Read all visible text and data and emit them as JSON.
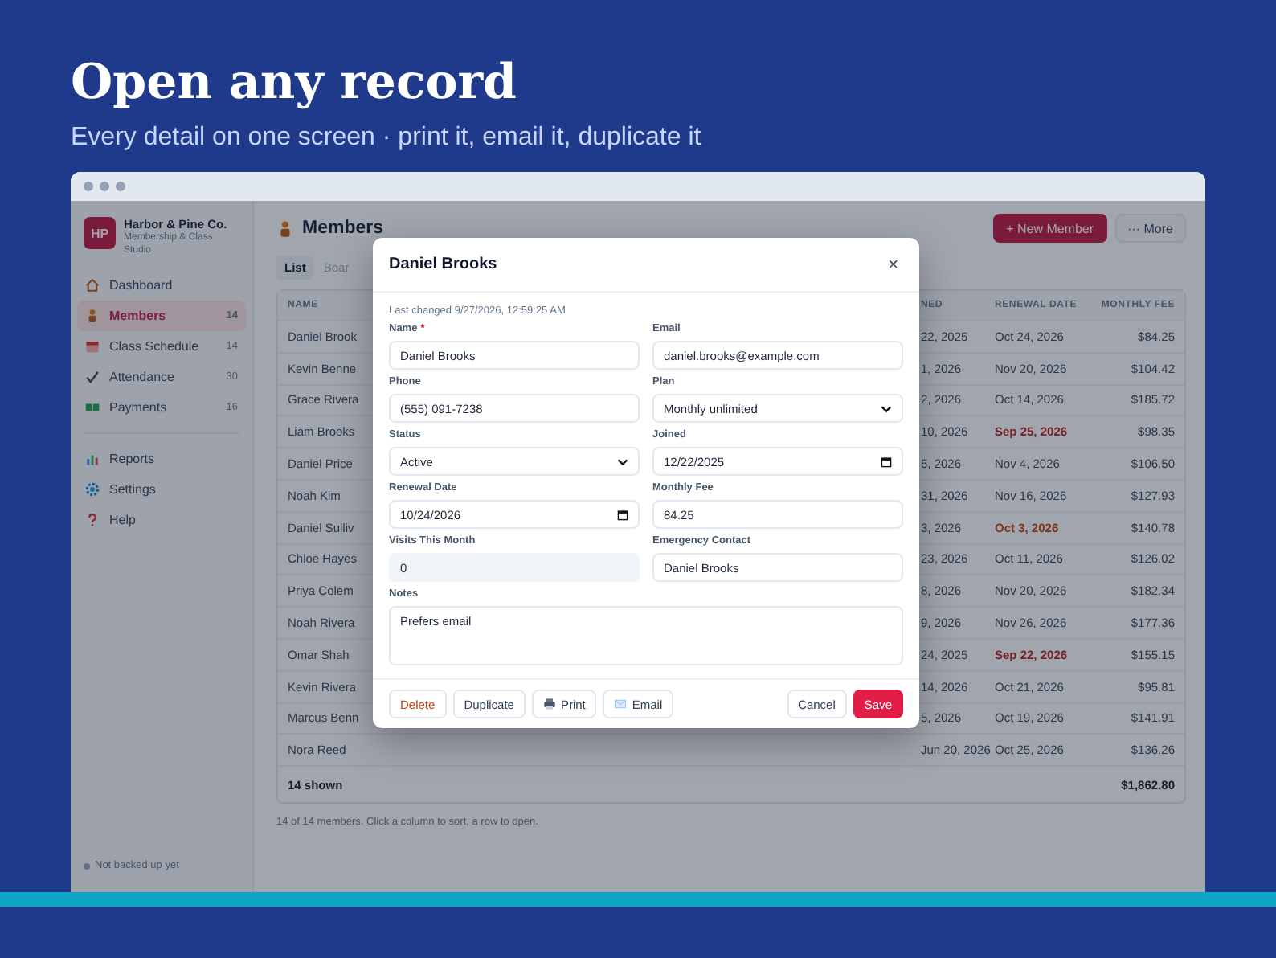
{
  "hero": {
    "title": "Open any record",
    "subtitle": "Every detail on one screen · print it, email it, duplicate it"
  },
  "app": {
    "brand": {
      "logo": "HP",
      "name": "Harbor & Pine Co.",
      "tagline": "Membership & Class Studio"
    },
    "nav_main": [
      {
        "label": "Dashboard",
        "selected": false
      },
      {
        "label": "Members",
        "count": "14",
        "selected": true
      },
      {
        "label": "Class Schedule",
        "count": "14",
        "selected": false
      },
      {
        "label": "Attendance",
        "count": "30",
        "selected": false
      },
      {
        "label": "Payments",
        "count": "16",
        "selected": false
      }
    ],
    "nav_secondary": [
      {
        "label": "Reports",
        "selected": false
      },
      {
        "label": "Settings",
        "selected": false
      },
      {
        "label": "Help",
        "selected": false
      }
    ],
    "backup_status": "Not backed up yet",
    "page_title": "Members",
    "actions": [
      {
        "kind": "primary",
        "label": "+ New Member"
      },
      {
        "kind": "plain",
        "label": "··· More"
      }
    ],
    "tabs": [
      {
        "label": "List",
        "selected": true
      },
      {
        "label": "Boar",
        "selected": false
      }
    ],
    "table": {
      "columns": [
        "NAME",
        "NED",
        "RENEWAL DATE",
        "MONTHLY FEE"
      ],
      "rows": [
        {
          "name": "Daniel Brook",
          "column_2": "22, 2025",
          "renewal": "Oct 24, 2026",
          "overdue": false,
          "due_soon": false,
          "fee": "$84.25"
        },
        {
          "name": "Kevin Benne",
          "column_2": "1, 2026",
          "renewal": "Nov 20, 2026",
          "overdue": false,
          "due_soon": false,
          "fee": "$104.42"
        },
        {
          "name": "Grace Rivera",
          "column_2": "2, 2026",
          "renewal": "Oct 14, 2026",
          "overdue": false,
          "due_soon": false,
          "fee": "$185.72"
        },
        {
          "name": "Liam Brooks",
          "column_2": "10, 2026",
          "renewal": "Sep 25, 2026",
          "overdue": true,
          "due_soon": false,
          "fee": "$98.35"
        },
        {
          "name": "Daniel Price",
          "column_2": "5, 2026",
          "renewal": "Nov 4, 2026",
          "overdue": false,
          "due_soon": false,
          "fee": "$106.50"
        },
        {
          "name": "Noah Kim",
          "column_2": "31, 2026",
          "renewal": "Nov 16, 2026",
          "overdue": false,
          "due_soon": false,
          "fee": "$127.93"
        },
        {
          "name": "Daniel Sulliv",
          "column_2": "3, 2026",
          "renewal": "Oct 3, 2026",
          "overdue": false,
          "due_soon": true,
          "fee": "$140.78"
        },
        {
          "name": "Chloe Hayes",
          "column_2": "23, 2026",
          "renewal": "Oct 11, 2026",
          "overdue": false,
          "due_soon": false,
          "fee": "$126.02"
        },
        {
          "name": "Priya Colem",
          "column_2": "8, 2026",
          "renewal": "Nov 20, 2026",
          "overdue": false,
          "due_soon": false,
          "fee": "$182.34"
        },
        {
          "name": "Noah Rivera",
          "column_2": "9, 2026",
          "renewal": "Nov 26, 2026",
          "overdue": false,
          "due_soon": false,
          "fee": "$177.36"
        },
        {
          "name": "Omar Shah",
          "column_2": "24, 2025",
          "renewal": "Sep 22, 2026",
          "overdue": true,
          "due_soon": false,
          "fee": "$155.15"
        },
        {
          "name": "Kevin Rivera",
          "column_2": "14, 2026",
          "renewal": "Oct 21, 2026",
          "overdue": false,
          "due_soon": false,
          "fee": "$95.81"
        },
        {
          "name": "Marcus Benn",
          "column_2": "5, 2026",
          "renewal": "Oct 19, 2026",
          "overdue": false,
          "due_soon": false,
          "fee": "$141.91"
        },
        {
          "name": "Nora Reed",
          "column_2": "Jun 20, 2026",
          "renewal": "Oct 25, 2026",
          "overdue": false,
          "due_soon": false,
          "fee": "$136.26"
        }
      ],
      "footer": {
        "count": "14 shown",
        "total": "$1,862.80"
      }
    },
    "caption": "14 of 14 members. Click a column to sort, a row to open."
  },
  "dialog": {
    "title": "Daniel Brooks",
    "close": "×",
    "last_changed": "Last changed 9/27/2026, 12:59:25 AM",
    "fields": [
      {
        "label": "Name",
        "required_mark": "*",
        "kind": "text",
        "value": "Daniel Brooks"
      },
      {
        "label": "Email",
        "kind": "text",
        "value": "daniel.brooks@example.com"
      },
      {
        "label": "Phone",
        "kind": "text",
        "value": "(555) 091-7238"
      },
      {
        "label": "Plan",
        "kind": "select",
        "value": "Monthly unlimited"
      },
      {
        "label": "Status",
        "kind": "select",
        "value": "Active"
      },
      {
        "label": "Joined",
        "kind": "date",
        "value": "12/22/2025"
      },
      {
        "label": "Renewal Date",
        "kind": "date",
        "value": "10/24/2026"
      },
      {
        "label": "Monthly Fee",
        "kind": "text",
        "value": "84.25"
      },
      {
        "label": "Visits This Month",
        "kind": "readonly",
        "value": "0"
      },
      {
        "label": "Emergency Contact",
        "kind": "text",
        "value": "Daniel Brooks"
      },
      {
        "label": "Notes",
        "kind": "textarea",
        "value": "Prefers email"
      }
    ],
    "left_buttons": [
      {
        "kind": "danger",
        "label": "Delete"
      },
      {
        "kind": "plain",
        "label": "Duplicate"
      },
      {
        "kind": "print",
        "label": "Print"
      },
      {
        "kind": "email",
        "label": "Email"
      }
    ],
    "right_buttons": [
      {
        "kind": "plain",
        "label": "Cancel"
      },
      {
        "kind": "primary",
        "label": "Save"
      }
    ]
  }
}
